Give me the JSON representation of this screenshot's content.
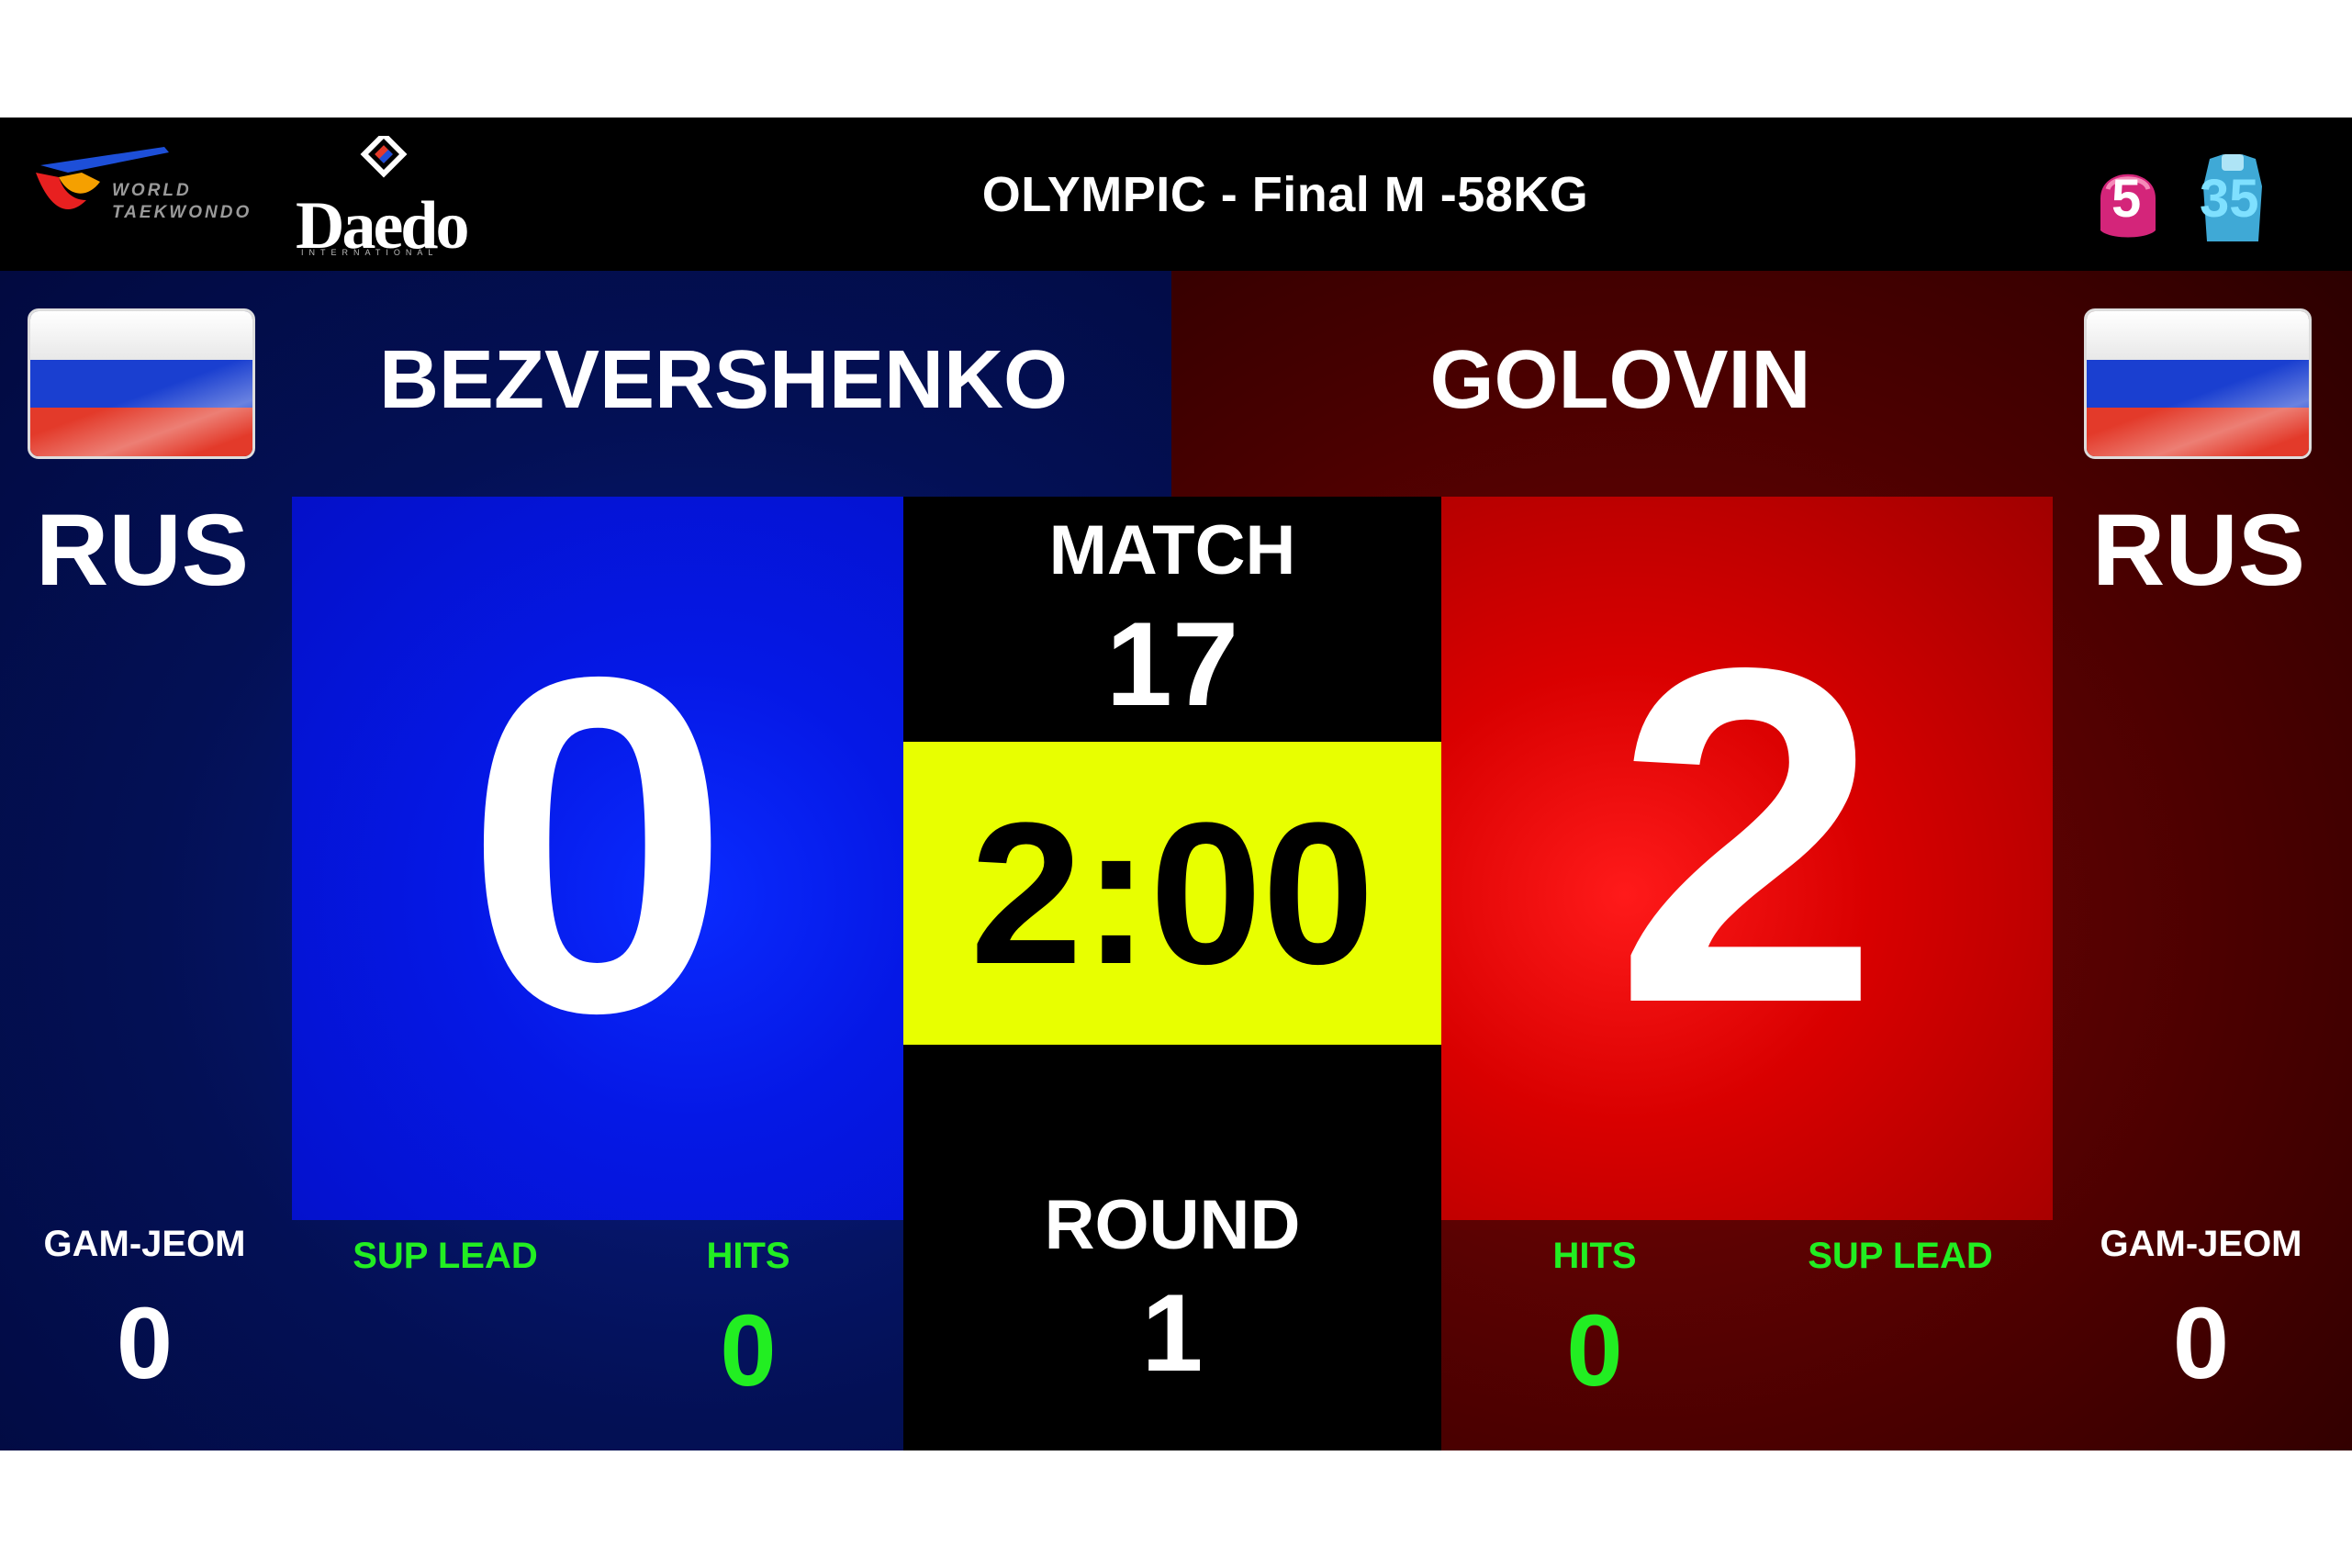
{
  "header": {
    "title": "OLYMPIC - Final M -58KG",
    "logos": {
      "world_taekwondo": "WORLD\nTAEKWONDO",
      "daedo": "Daedo",
      "daedo_sub": "INTERNATIONAL"
    },
    "helmet_sensor_value": "5",
    "body_sensor_value": "35"
  },
  "blue": {
    "name": "BEZVERSHENKO",
    "country": "RUS",
    "score": "0",
    "gam_jeom_label": "GAM-JEOM",
    "gam_jeom": "0",
    "sup_lead_label": "SUP LEAD",
    "hits_label": "HITS",
    "hits": "0"
  },
  "red": {
    "name": "GOLOVIN",
    "country": "RUS",
    "score": "2",
    "gam_jeom_label": "GAM-JEOM",
    "gam_jeom": "0",
    "sup_lead_label": "SUP LEAD",
    "hits_label": "HITS",
    "hits": "0"
  },
  "center": {
    "match_label": "MATCH",
    "match_number": "17",
    "timer": "2:00",
    "round_label": "ROUND",
    "round_number": "1"
  },
  "colors": {
    "blue_panel": "#0518e6",
    "red_panel": "#d90000",
    "timer_bg": "#e8ff00",
    "stat_green": "#22ee22"
  }
}
